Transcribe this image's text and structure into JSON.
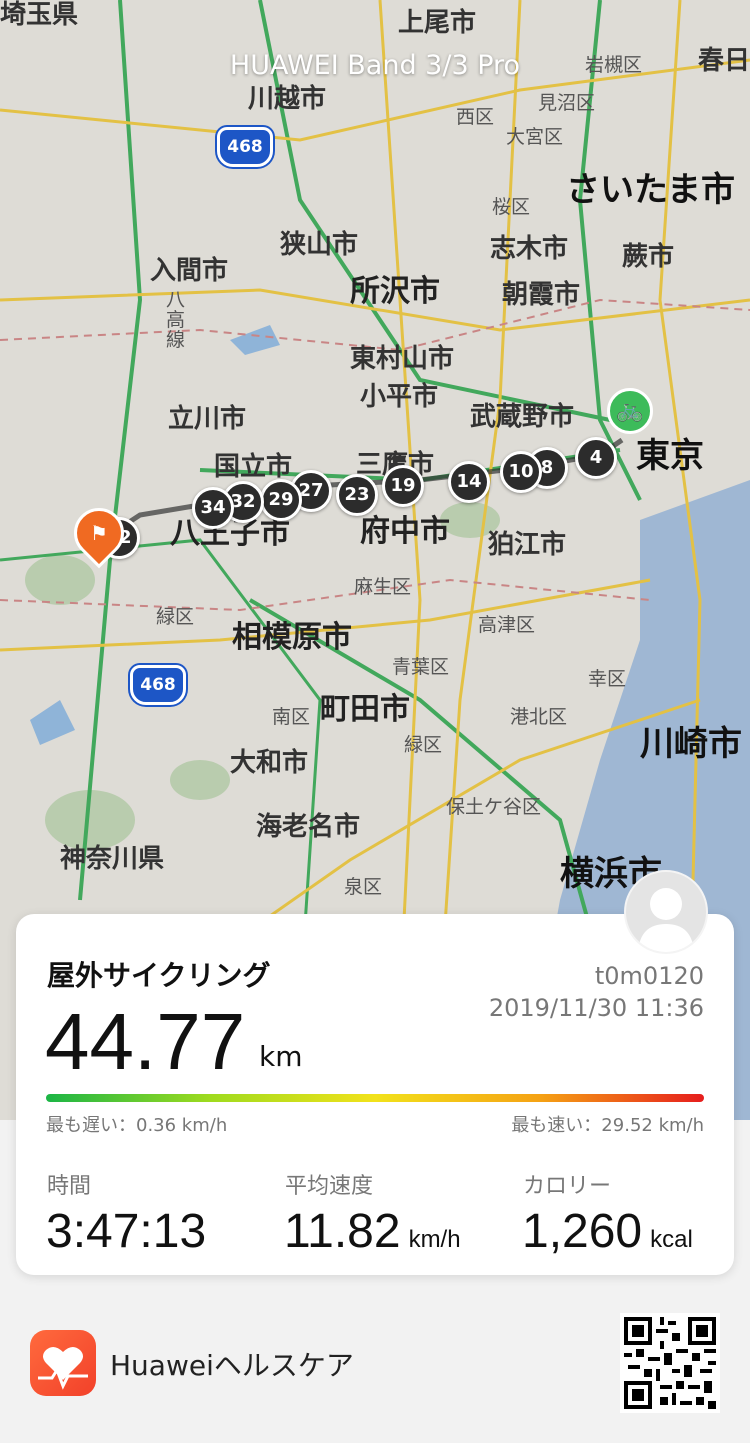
{
  "device_name": "HUAWEI Band 3/3 Pro",
  "map": {
    "labels": [
      {
        "text": "埼玉県",
        "size": "mid"
      },
      {
        "text": "上尾市",
        "size": "mid"
      },
      {
        "text": "春日",
        "size": "mid"
      },
      {
        "text": "岩槻区",
        "size": "small"
      },
      {
        "text": "川越市",
        "size": "mid"
      },
      {
        "text": "西区",
        "size": "small"
      },
      {
        "text": "見沼区",
        "size": "small"
      },
      {
        "text": "大宮区",
        "size": "small"
      },
      {
        "text": "さいたま市",
        "size": "huge"
      },
      {
        "text": "桜区",
        "size": "small"
      },
      {
        "text": "狭山市",
        "size": "mid"
      },
      {
        "text": "志木市",
        "size": "mid"
      },
      {
        "text": "蕨市",
        "size": "mid"
      },
      {
        "text": "入間市",
        "size": "mid"
      },
      {
        "text": "所沢市",
        "size": "big"
      },
      {
        "text": "朝霞市",
        "size": "mid"
      },
      {
        "text": "東村山市",
        "size": "mid"
      },
      {
        "text": "小平市",
        "size": "mid"
      },
      {
        "text": "立川市",
        "size": "mid"
      },
      {
        "text": "武蔵野市",
        "size": "mid"
      },
      {
        "text": "東京",
        "size": "huge"
      },
      {
        "text": "国立市",
        "size": "mid"
      },
      {
        "text": "三鷹市",
        "size": "mid"
      },
      {
        "text": "八王子市",
        "size": "big"
      },
      {
        "text": "府中市",
        "size": "big"
      },
      {
        "text": "狛江市",
        "size": "mid"
      },
      {
        "text": "麻生区",
        "size": "small"
      },
      {
        "text": "緑区",
        "size": "small"
      },
      {
        "text": "相模原市",
        "size": "big"
      },
      {
        "text": "高津区",
        "size": "small"
      },
      {
        "text": "青葉区",
        "size": "small"
      },
      {
        "text": "幸区",
        "size": "small"
      },
      {
        "text": "町田市",
        "size": "big"
      },
      {
        "text": "南区",
        "size": "small"
      },
      {
        "text": "港北区",
        "size": "small"
      },
      {
        "text": "川崎市",
        "size": "huge"
      },
      {
        "text": "大和市",
        "size": "mid"
      },
      {
        "text": "緑区",
        "size": "small"
      },
      {
        "text": "海老名市",
        "size": "mid"
      },
      {
        "text": "保土ケ谷区",
        "size": "small"
      },
      {
        "text": "神奈川県",
        "size": "mid"
      },
      {
        "text": "横浜市",
        "size": "huge"
      },
      {
        "text": "泉区",
        "size": "small"
      },
      {
        "text": "八高線",
        "size": "small"
      }
    ],
    "route_shields": [
      "468",
      "468"
    ],
    "km_markers": [
      "4",
      "8",
      "10",
      "14",
      "19",
      "23",
      "27",
      "29",
      "32",
      "34",
      "42"
    ]
  },
  "activity": {
    "type": "屋外サイクリング",
    "user": "t0m0120",
    "datetime": "2019/11/30 11:36",
    "distance": "44.77",
    "distance_unit": "km",
    "slowest": "最も遅い：0.36 km/h",
    "fastest": "最も速い：29.52 km/h",
    "stats": [
      {
        "label": "時間",
        "value": "3:47:13",
        "unit": ""
      },
      {
        "label": "平均速度",
        "value": "11.82",
        "unit": "km/h"
      },
      {
        "label": "カロリー",
        "value": "1,260",
        "unit": "kcal"
      }
    ]
  },
  "footer": {
    "app_name": "Huaweiヘルスケア"
  }
}
